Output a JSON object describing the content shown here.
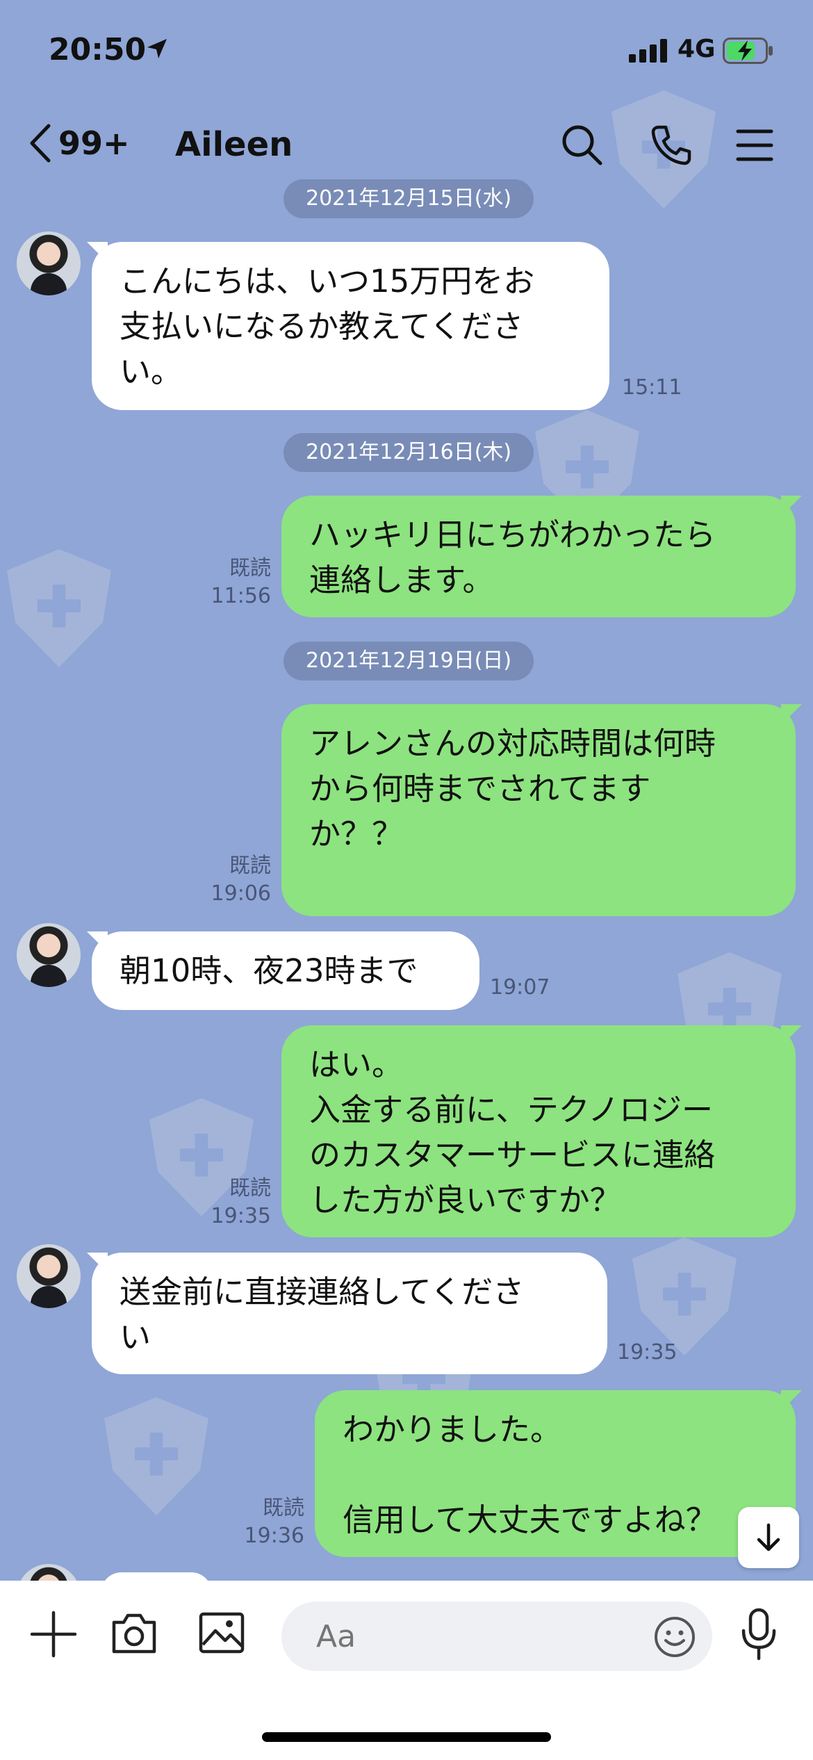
{
  "status_bar": {
    "time": "20:50",
    "network": "4G"
  },
  "nav": {
    "unread_count": "99+",
    "contact_name": "Aileen"
  },
  "dates": [
    "2021年12月15日(水)",
    "2021年12月16日(木)",
    "2021年12月19日(日)"
  ],
  "messages": [
    {
      "dir": "in",
      "text": "こんにちは、いつ15万円をお\n支払いになるか教えてくださ\nい。",
      "time": "15:11"
    },
    {
      "dir": "out",
      "text": "ハッキリ日にちがわかったら\n連絡します。",
      "read": "既読",
      "time": "11:56"
    },
    {
      "dir": "out",
      "text": "アレンさんの対応時間は何時\nから何時までされてます\nか？？",
      "read": "既読",
      "time": "19:06"
    },
    {
      "dir": "in",
      "text": "朝10時、夜23時まで",
      "time": "19:07"
    },
    {
      "dir": "out",
      "text": "はい。\n入金する前に、テクノロジー\nのカスタマーサービスに連絡\nした方が良いですか？",
      "read": "既読",
      "time": "19:35"
    },
    {
      "dir": "in",
      "text": "送金前に直接連絡してくださ\nい",
      "time": "19:35"
    },
    {
      "dir": "out",
      "text": "わかりました。\n\n信用して大丈夫ですよね？",
      "read": "既読",
      "time": "19:36"
    }
  ],
  "input": {
    "placeholder": "Aa"
  },
  "colors": {
    "background": "#8fa6d6",
    "outgoing_bubble": "#8de37f",
    "incoming_bubble": "#ffffff"
  }
}
